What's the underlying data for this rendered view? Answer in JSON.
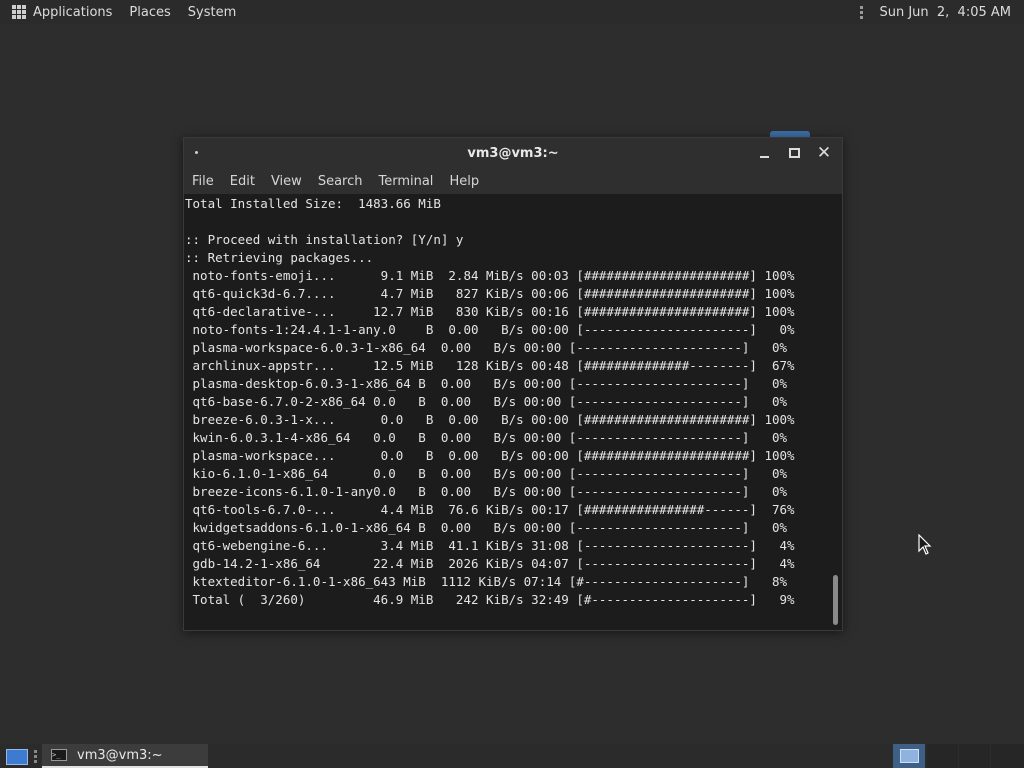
{
  "top_panel": {
    "applications": "Applications",
    "places": "Places",
    "system": "System",
    "clock": "Sun Jun  2,  4:05 AM"
  },
  "window": {
    "title": "vm3@vm3:~",
    "menu": [
      "File",
      "Edit",
      "View",
      "Search",
      "Terminal",
      "Help"
    ]
  },
  "terminal": {
    "lines": [
      "Total Installed Size:  1483.66 MiB",
      "",
      ":: Proceed with installation? [Y/n] y",
      ":: Retrieving packages...",
      " noto-fonts-emoji...      9.1 MiB  2.84 MiB/s 00:03 [######################] 100%",
      " qt6-quick3d-6.7....      4.7 MiB   827 KiB/s 00:06 [######################] 100%",
      " qt6-declarative-...     12.7 MiB   830 KiB/s 00:16 [######################] 100%",
      " noto-fonts-1:24.4.1-1-any.0    B  0.00   B/s 00:00 [----------------------]   0%",
      " plasma-workspace-6.0.3-1-x86_64  0.00   B/s 00:00 [----------------------]   0%",
      " archlinux-appstr...     12.5 MiB   128 KiB/s 00:48 [##############--------]  67%",
      " plasma-desktop-6.0.3-1-x86_64 B  0.00   B/s 00:00 [----------------------]   0%",
      " qt6-base-6.7.0-2-x86_64 0.0   B  0.00   B/s 00:00 [----------------------]   0%",
      " breeze-6.0.3-1-x...      0.0   B  0.00   B/s 00:00 [######################] 100%",
      " kwin-6.0.3.1-4-x86_64   0.0   B  0.00   B/s 00:00 [----------------------]   0%",
      " plasma-workspace...      0.0   B  0.00   B/s 00:00 [######################] 100%",
      " kio-6.1.0-1-x86_64      0.0   B  0.00   B/s 00:00 [----------------------]   0%",
      " breeze-icons-6.1.0-1-any0.0   B  0.00   B/s 00:00 [----------------------]   0%",
      " qt6-tools-6.7.0-...      4.4 MiB  76.6 KiB/s 00:17 [################------]  76%",
      " kwidgetsaddons-6.1.0-1-x86_64 B  0.00   B/s 00:00 [----------------------]   0%",
      " qt6-webengine-6...       3.4 MiB  41.1 KiB/s 31:08 [----------------------]   4%",
      " gdb-14.2-1-x86_64       22.4 MiB  2026 KiB/s 04:07 [----------------------]   4%",
      " ktexteditor-6.1.0-1-x86_643 MiB  1112 KiB/s 07:14 [#---------------------]   8%",
      " Total (  3/260)         46.9 MiB   242 KiB/s 32:49 [#---------------------]   9%"
    ]
  },
  "taskbar": {
    "task_label": "vm3@vm3:~"
  },
  "colors": {
    "desktop_bg": "#2d2d2d",
    "terminal_bg": "#1c1c1c",
    "accent": "#3d7bd0"
  }
}
